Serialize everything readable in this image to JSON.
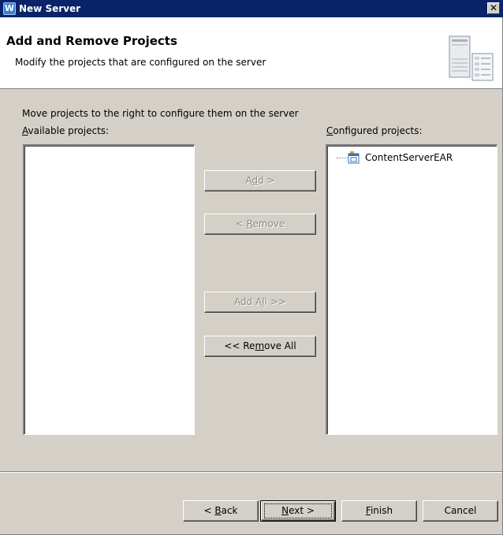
{
  "window": {
    "title": "New Server",
    "close_glyph": "✕"
  },
  "header": {
    "title": "Add and Remove Projects",
    "subtitle": "Modify the projects that are configured on the server",
    "art_icon": "server-wizard-banner-icon"
  },
  "body": {
    "instruction": "Move projects to the right to configure them on the server",
    "available_label_mnemonic": "A",
    "available_label_rest": "vailable projects:",
    "configured_label_mnemonic": "C",
    "configured_label_rest": "onfigured projects:",
    "available_projects": [],
    "configured_projects": [
      {
        "label": "ContentServerEAR",
        "icon": "ear-project-icon"
      }
    ]
  },
  "buttons": {
    "add_pre": "A",
    "add_mn": "d",
    "add_post": "d >",
    "remove_pre": "< ",
    "remove_mn": "R",
    "remove_post": "emove",
    "addall_pre": "Add A",
    "addall_mn": "l",
    "addall_post": "l >>",
    "removeall_pre": "<< Re",
    "removeall_mn": "m",
    "removeall_post": "ove All"
  },
  "footer": {
    "back_pre": "< ",
    "back_mn": "B",
    "back_post": "ack",
    "next_mn": "N",
    "next_post": "ext >",
    "finish_mn": "F",
    "finish_post": "inish",
    "cancel": "Cancel"
  },
  "colors": {
    "titlebar": "#0a246a",
    "dialog_bg": "#d4d0c8",
    "disabled_text": "#8f8b82"
  }
}
